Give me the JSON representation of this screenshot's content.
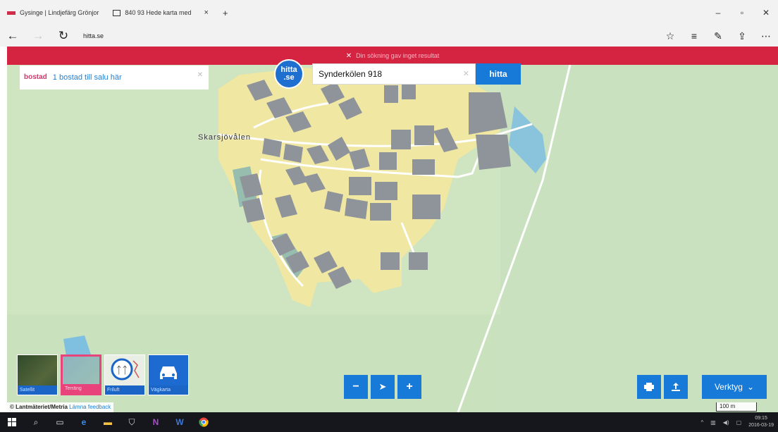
{
  "browser": {
    "tabs": [
      {
        "title": "Gysinge | Lindjefärg Grönjor",
        "active": false
      },
      {
        "title": "840 93 Hede karta med",
        "active": true
      }
    ],
    "new_tab": "+",
    "tab_close": "×",
    "url_host": "hitta.se",
    "window_buttons": {
      "minimize": "–",
      "restore": "▫",
      "close": "✕"
    }
  },
  "page": {
    "error_banner": "Din sökning gav inget resultat",
    "promo": {
      "brand_line1": "bostad",
      "text": "1 bostad till salu här"
    },
    "logo": {
      "line1": "hitta",
      "line2": ".se"
    },
    "search": {
      "value": "Synderkölen 918",
      "button": "hitta"
    },
    "map": {
      "place_label": "Skarsjövålen",
      "map_types": [
        {
          "label": "Satellit",
          "active": false
        },
        {
          "label": "Terräng",
          "active": true
        },
        {
          "label": "Friluft",
          "active": false
        },
        {
          "label": "Vägkarta",
          "active": false
        }
      ],
      "zoom_out": "−",
      "locate": "➤",
      "zoom_in": "+",
      "tools_button": "Verktyg",
      "attribution": "© Lantmäteriet/Metria",
      "feedback_link": "Lämna feedback",
      "scale": "100 m"
    }
  },
  "taskbar": {
    "clock_time": "09:15",
    "clock_date": "2016-03-19"
  },
  "colors": {
    "banner": "#d52342",
    "accent_blue": "#1779d8",
    "map_green": "#cfe4c0",
    "map_yellow": "#efe7a2",
    "buildings": "#8f939a",
    "water": "#8ac4dc"
  }
}
